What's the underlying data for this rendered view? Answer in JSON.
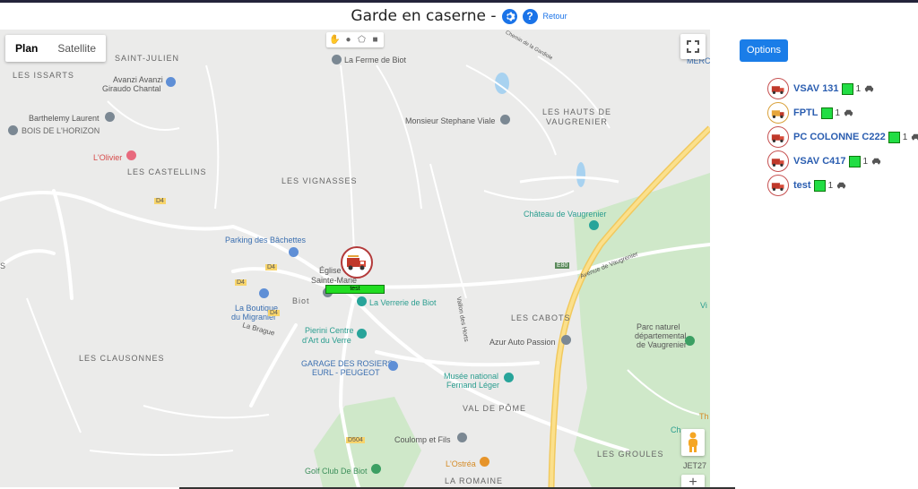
{
  "header": {
    "title": "Garde en caserne -",
    "settings_icon": "gear-icon",
    "help_icon": "question-icon",
    "help_glyph": "?",
    "back_label": "Retour"
  },
  "map": {
    "tabs": [
      {
        "label": "Plan",
        "active": true
      },
      {
        "label": "Satellite",
        "active": false
      }
    ],
    "draw_tools": [
      "hand-icon",
      "circle-icon",
      "polygon-icon",
      "rectangle-icon"
    ],
    "zoom_in_label": "+",
    "areas": [
      "SAINT-JULIEN",
      "LES ISSARTS",
      "LES CASTELLINS",
      "LES VIGNASSES",
      "LES HAUTS DE",
      "VAUGRENIER",
      "LES CABOTS",
      "LES CLAUSONNES",
      "VAL DE PÔME",
      "LES GROULES",
      "LA ROMAINE",
      "BOIS DE L'HORIZON",
      "S",
      "Biot"
    ],
    "places": [
      "La Ferme de Biot",
      "Avanzi Avanzi",
      "Giraudo Chantal",
      "Barthelemy Laurent",
      "L'Olivier",
      "Monsieur Stephane Viale",
      "Château de Vaugrenier",
      "Parking des Bâchettes",
      "Église",
      "Sainte-Marie",
      "La Boutique",
      "du Migranier",
      "La Verrerie de Biot",
      "Pierini Centre",
      "d'Art du Verre",
      "GARAGE DES ROSIERS",
      "EURL - PEUGEOT",
      "Azur Auto Passion",
      "Parc naturel",
      "départemental",
      "de Vaugrenier",
      "Musée national",
      "Fernand Léger",
      "Coulomp et Fils",
      "L'Ostréa",
      "Golf Club De Biot",
      "JET27",
      "MERC",
      "Vi",
      "Th",
      "Vi",
      "Ch"
    ],
    "roads": [
      "D4",
      "D4",
      "D4",
      "D4",
      "E80",
      "D504",
      "Avenue de Vaugrenier",
      "La Brague",
      "Vallon des Horts",
      "Chemin de la Gardiole"
    ],
    "marker": {
      "label": "test",
      "icon": "fire-truck-icon"
    }
  },
  "panel": {
    "options_label": "Options",
    "vehicles": [
      {
        "name": "VSAV 131",
        "count": "1",
        "status_color": "#22dd44"
      },
      {
        "name": "FPTL",
        "count": "1",
        "status_color": "#22dd44"
      },
      {
        "name": "PC COLONNE C222",
        "count": "1",
        "status_color": "#22dd44"
      },
      {
        "name": "VSAV C417",
        "count": "1",
        "status_color": "#22dd44"
      },
      {
        "name": "test",
        "count": "1",
        "status_color": "#22dd44"
      }
    ]
  },
  "colors": {
    "accent": "#1a7de8",
    "vehicle_link": "#2a5db0",
    "status_green": "#22dd44",
    "highway": "#f7d46b",
    "park": "#cfe8c9",
    "water": "#a8d2f0"
  }
}
